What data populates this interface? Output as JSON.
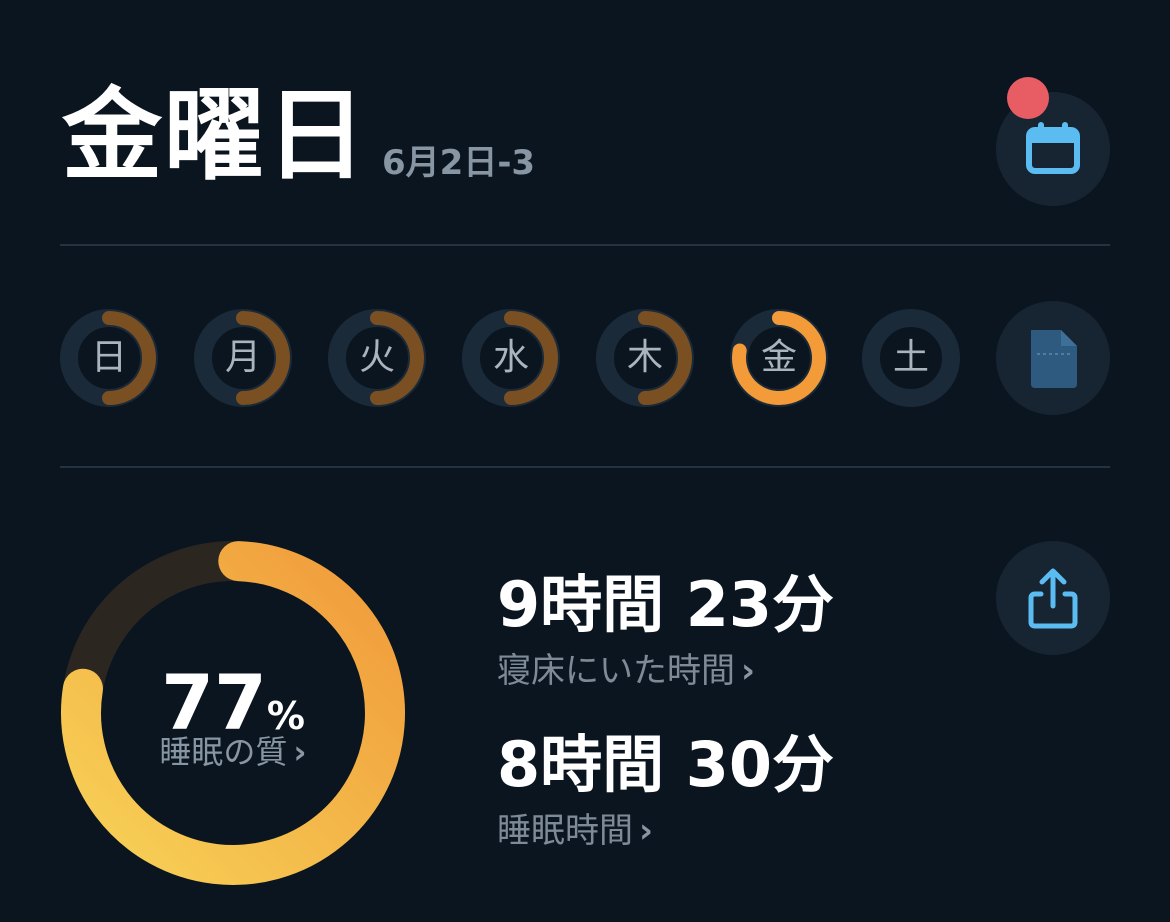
{
  "header": {
    "title": "金曜日",
    "subtitle": "6月2日-3",
    "calendar_button_icon": "calendar-icon",
    "notification_badge_color": "#e85d63"
  },
  "week": {
    "days": [
      {
        "label": "日",
        "progress": 0.5,
        "selected": false
      },
      {
        "label": "月",
        "progress": 0.5,
        "selected": false
      },
      {
        "label": "火",
        "progress": 0.5,
        "selected": false
      },
      {
        "label": "水",
        "progress": 0.5,
        "selected": false
      },
      {
        "label": "木",
        "progress": 0.5,
        "selected": false
      },
      {
        "label": "金",
        "progress": 0.78,
        "selected": true
      },
      {
        "label": "土",
        "progress": 0,
        "selected": false
      }
    ],
    "note_button_icon": "document-icon",
    "colors": {
      "track": "#1a2a39",
      "ring": "#7a4f22",
      "ring_selected": "#f29b38"
    }
  },
  "sleep": {
    "quality_value": "77",
    "quality_unit": "%",
    "quality_label": "睡眠の質",
    "quality_fraction": 0.77,
    "ring_colors": {
      "track": "#2b2620",
      "start": "#f7d257",
      "end": "#f09a3a"
    },
    "time_in_bed_value": "9時間 23分",
    "time_in_bed_label": "寝床にいた時間",
    "sleep_time_value": "8時間 30分",
    "sleep_time_label": "睡眠時間",
    "chevron": "›",
    "share_button_icon": "share-icon",
    "accent": "#5bbcf2"
  }
}
